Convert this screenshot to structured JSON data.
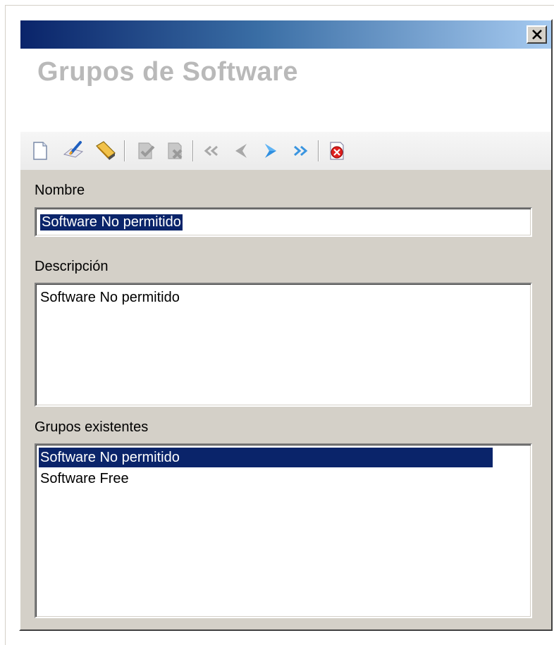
{
  "window": {
    "header_title": "Grupos de Software",
    "close_label": "×"
  },
  "toolbar": {
    "buttons": [
      {
        "name": "new-icon",
        "enabled": true
      },
      {
        "name": "edit-icon",
        "enabled": true
      },
      {
        "name": "delete-icon",
        "enabled": true
      },
      {
        "name": "accept-icon",
        "enabled": false
      },
      {
        "name": "cancel-icon",
        "enabled": false
      },
      {
        "name": "first-record-icon",
        "enabled": false
      },
      {
        "name": "previous-record-icon",
        "enabled": false
      },
      {
        "name": "next-record-icon",
        "enabled": true
      },
      {
        "name": "last-record-icon",
        "enabled": true
      },
      {
        "name": "exit-icon",
        "enabled": true
      }
    ]
  },
  "form": {
    "name_label": "Nombre",
    "name_value": "Software No permitido",
    "description_label": "Descripción",
    "description_value": "Software No permitido",
    "groups_label": "Grupos existentes",
    "groups": [
      {
        "label": "Software No permitido",
        "selected": true
      },
      {
        "label": "Software Free",
        "selected": false
      }
    ]
  },
  "colors": {
    "title_gradient_start": "#0a246a",
    "title_gradient_end": "#a6caf0",
    "selection": "#0a246a",
    "dialog_bg": "#d4d0c8"
  }
}
